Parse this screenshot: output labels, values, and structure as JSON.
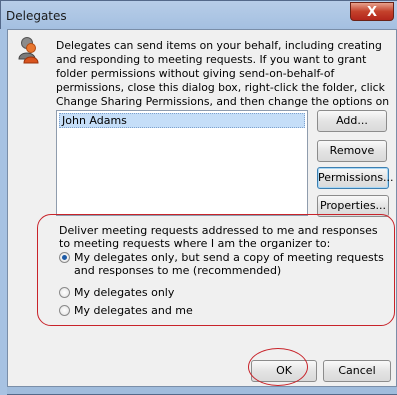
{
  "window": {
    "title": "Delegates",
    "close_label": "X"
  },
  "intro_text": "Delegates can send items on your behalf, including creating and responding to meeting requests. If you want to grant folder permissions without giving send-on-behalf-of permissions, close this dialog box, right-click the folder, click Change Sharing Permissions, and then change the options on the Permissions tab.",
  "delegates_list": {
    "items": [
      "John Adams"
    ]
  },
  "buttons": {
    "add": "Add...",
    "remove": "Remove",
    "permissions": "Permissions...",
    "properties": "Properties...",
    "ok": "OK",
    "cancel": "Cancel"
  },
  "meeting_requests": {
    "label": "Deliver meeting requests addressed to me and responses to meeting requests where I am the organizer to:",
    "options": [
      "My delegates only, but send a copy of meeting requests and responses to me (recommended)",
      "My delegates only",
      "My delegates and me"
    ],
    "selected_index": 0
  },
  "colors": {
    "annotation": "#c8232a",
    "selection": "#c5def8"
  },
  "icons": {
    "info": "people-icon",
    "close": "close-icon"
  }
}
